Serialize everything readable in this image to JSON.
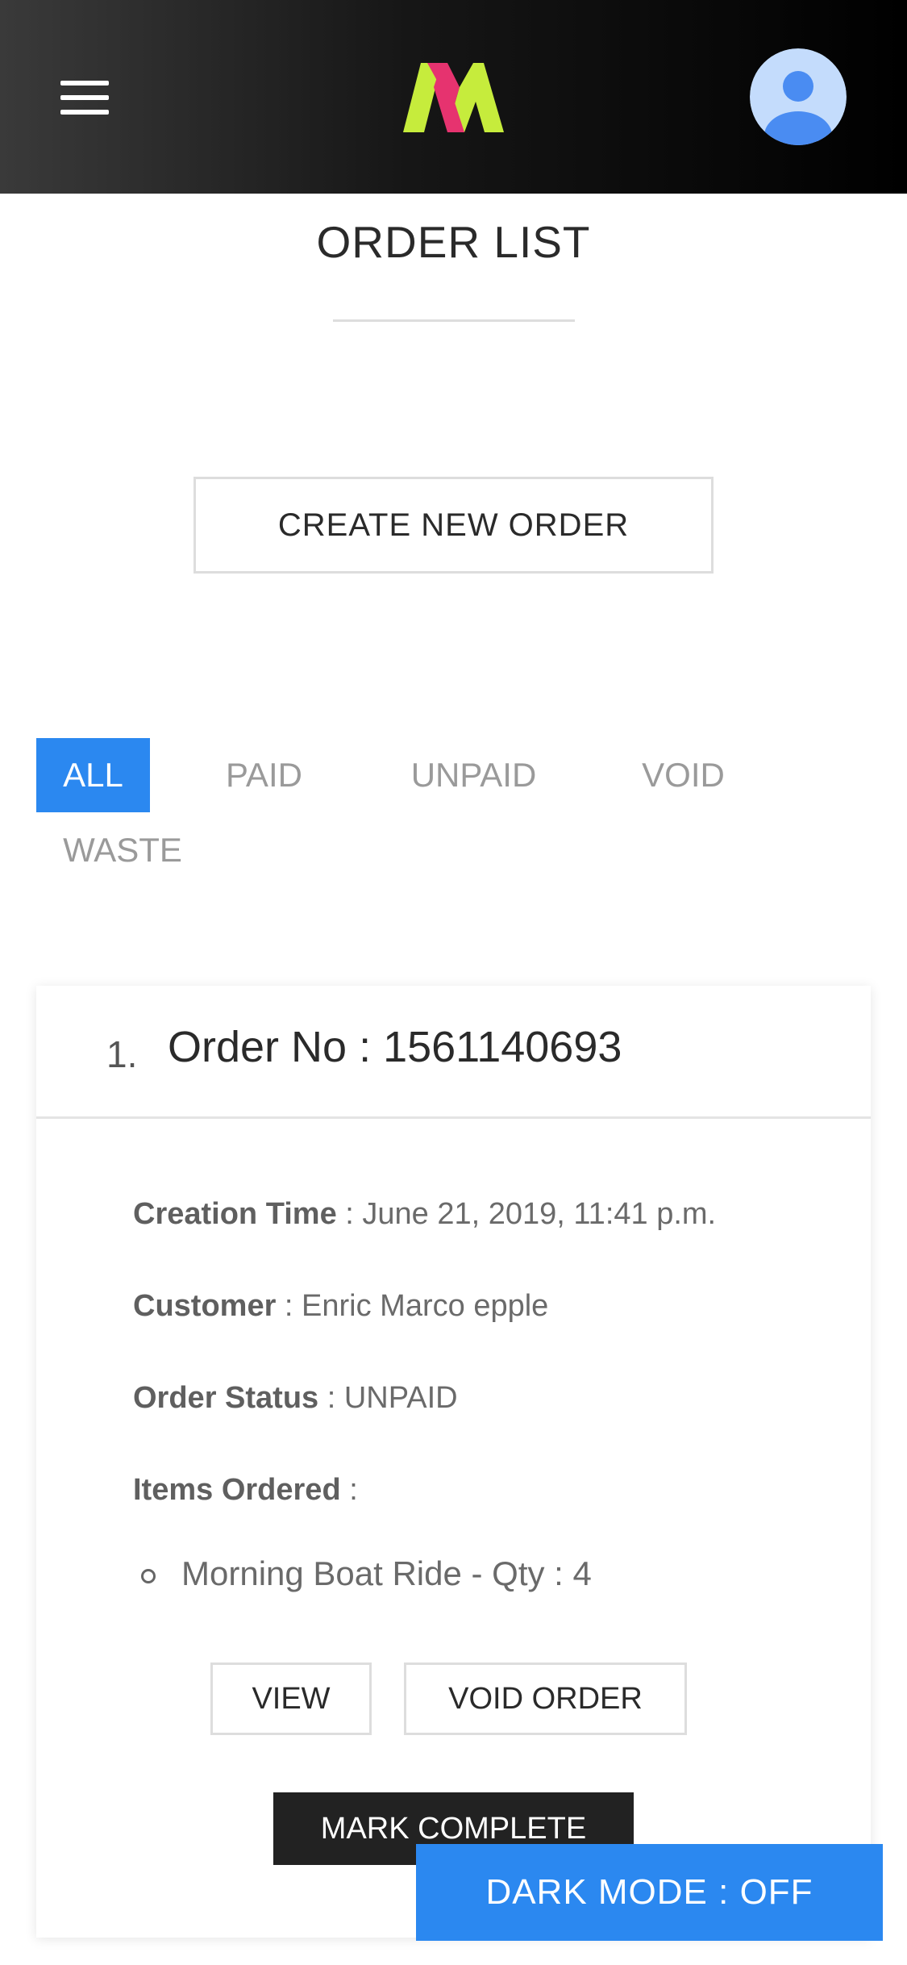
{
  "header": {
    "menu_icon": "hamburger-menu-icon",
    "logo_icon": "brand-logo-m",
    "avatar_icon": "user-avatar-icon",
    "colors": {
      "logo_primary": "#c6ec3c",
      "logo_accent": "#e6336f",
      "avatar_bg": "#c4dcfc",
      "avatar_fg": "#4a8cf2"
    }
  },
  "page": {
    "title": "ORDER LIST"
  },
  "actions": {
    "create_order_label": "CREATE NEW ORDER"
  },
  "filters": {
    "tabs": [
      {
        "label": "ALL",
        "active": true
      },
      {
        "label": "PAID",
        "active": false
      },
      {
        "label": "UNPAID",
        "active": false
      },
      {
        "label": "VOID",
        "active": false
      },
      {
        "label": "WASTE",
        "active": false
      }
    ],
    "active_color": "#2b88f0"
  },
  "orders": [
    {
      "index": "1.",
      "order_no": "Order No : 1561140693",
      "creation_time_label": "Creation Time",
      "creation_time_value": " : June 21, 2019, 11:41 p.m.",
      "customer_label": "Customer",
      "customer_value": " : Enric Marco epple",
      "status_label": "Order Status",
      "status_value": " : UNPAID",
      "items_label": "Items Ordered",
      "items_label_suffix": " :",
      "items": [
        "Morning Boat Ride - Qty : 4"
      ],
      "view_label": "VIEW",
      "void_label": "VOID ORDER",
      "complete_label": "MARK COMPLETE"
    }
  ],
  "dark_mode": {
    "label": "DARK MODE : OFF"
  }
}
